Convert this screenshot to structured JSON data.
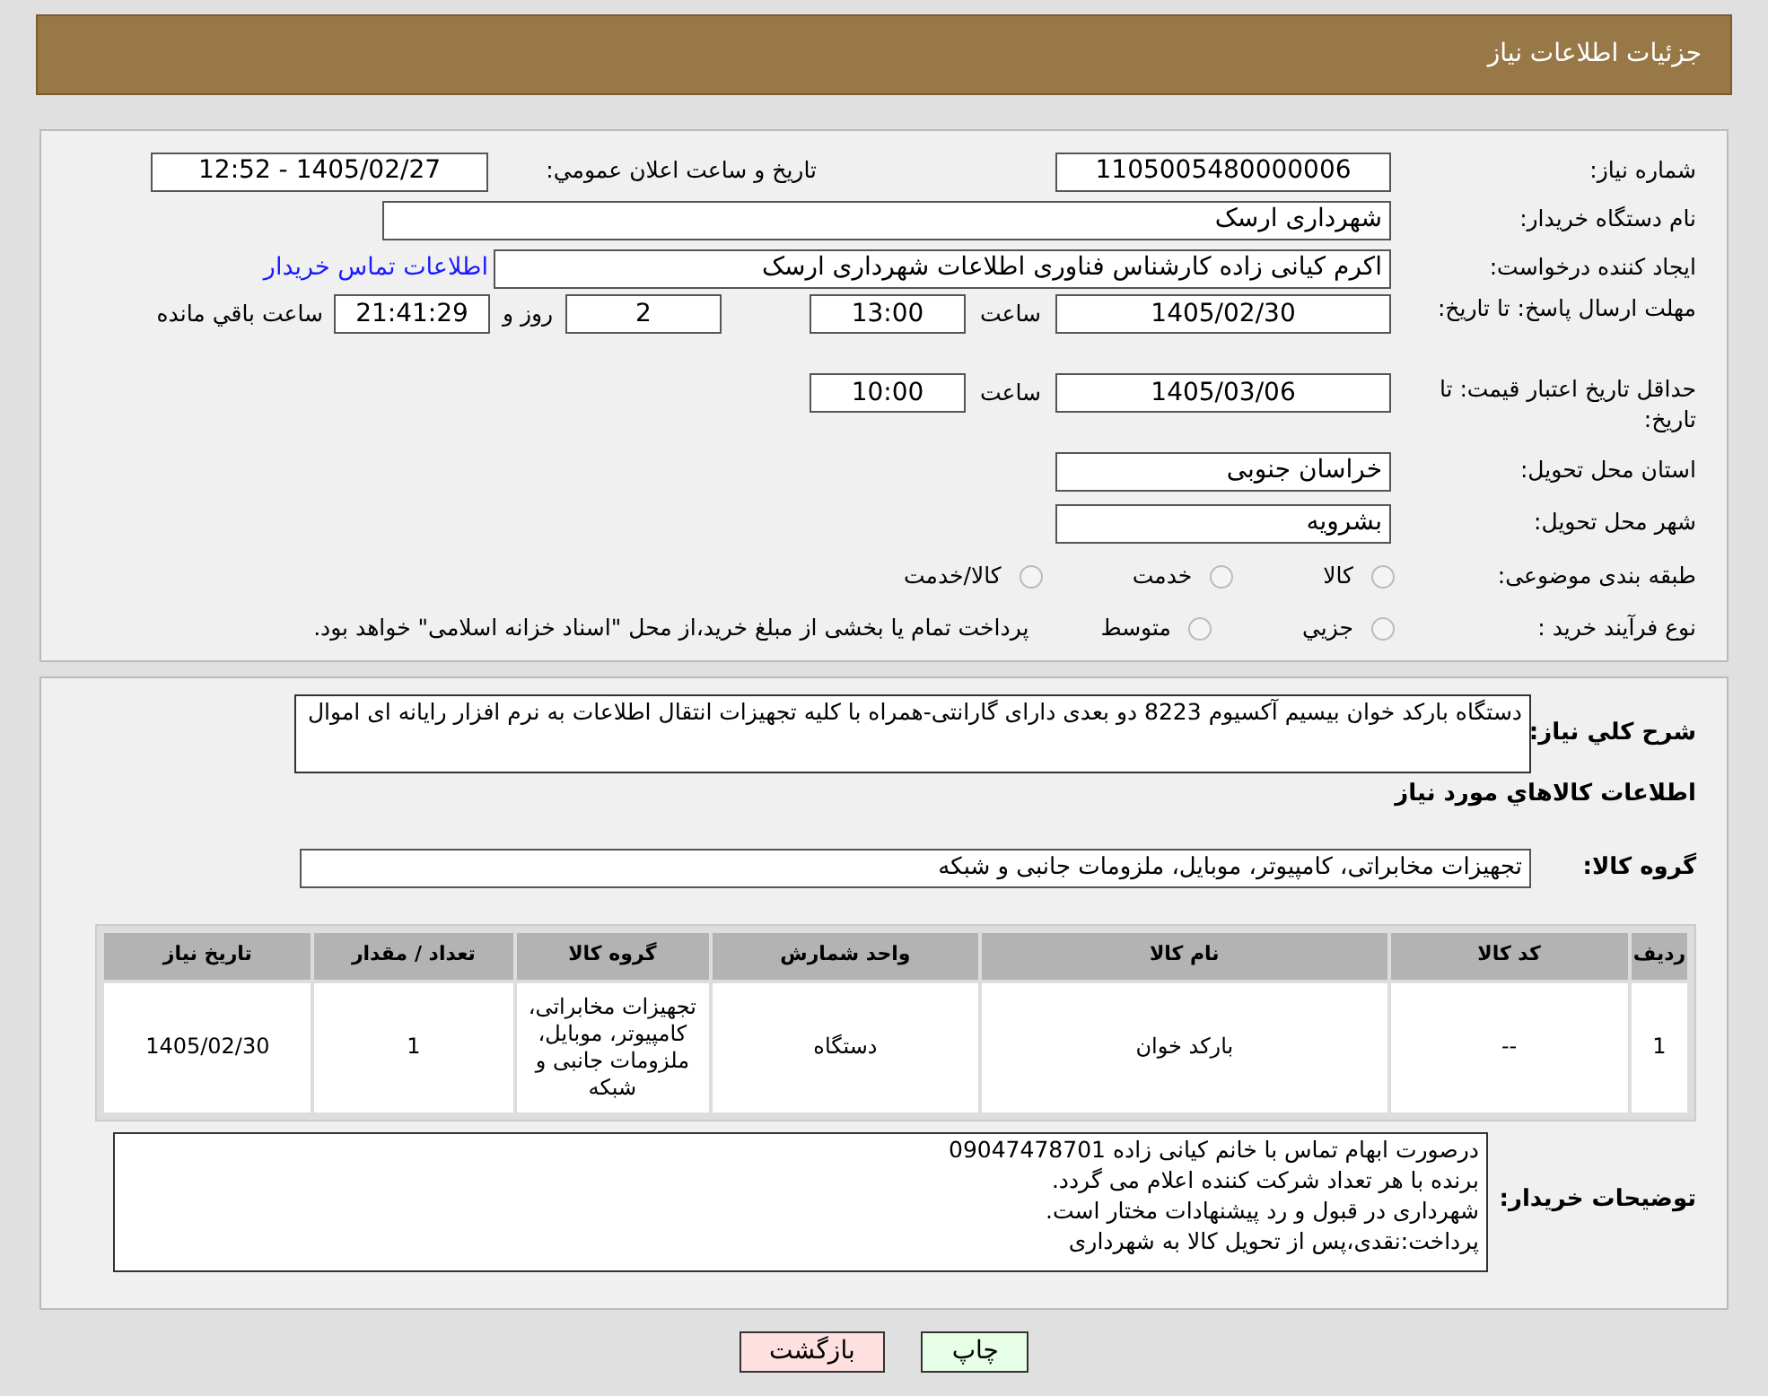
{
  "header": {
    "title": "جزئیات اطلاعات نیاز"
  },
  "need_number": {
    "label": "شماره نیاز:",
    "value": "1105005480000006"
  },
  "announce": {
    "label": "تاريخ و ساعت اعلان عمومي:",
    "value": "1405/02/27 - 12:52"
  },
  "buyer": {
    "label": "نام دستگاه خریدار:",
    "value": "شهرداری ارسک"
  },
  "creator": {
    "label": "ایجاد کننده درخواست:",
    "value": "اکرم کیانی زاده کارشناس فناوری اطلاعات شهرداری ارسک",
    "link": "اطلاعات تماس خریدار"
  },
  "deadline": {
    "label": "مهلت ارسال پاسخ: تا تاریخ:",
    "date": "1405/02/30",
    "time_label": "ساعت",
    "time": "13:00",
    "days": "2",
    "days_label": "روز و",
    "remaining": "21:41:29",
    "remaining_label": "ساعت باقي مانده"
  },
  "validity": {
    "label": "حداقل تاریخ اعتبار قیمت: تا تاریخ:",
    "date": "1405/03/06",
    "time_label": "ساعت",
    "time": "10:00"
  },
  "province": {
    "label": "استان محل تحویل:",
    "value": "خراسان جنوبی"
  },
  "city": {
    "label": "شهر محل تحویل:",
    "value": "بشرویه"
  },
  "category": {
    "label": "طبقه بندی موضوعی:",
    "options": [
      {
        "label": "کالا",
        "selected": false
      },
      {
        "label": "خدمت",
        "selected": false
      },
      {
        "label": "کالا/خدمت",
        "selected": false
      }
    ]
  },
  "process": {
    "label": "نوع فرآیند خرید :",
    "options": [
      {
        "label": "جزيي",
        "selected": false
      },
      {
        "label": "متوسط",
        "selected": false
      }
    ],
    "note": "پرداخت تمام یا بخشی از مبلغ خرید،از محل \"اسناد خزانه اسلامی\" خواهد بود."
  },
  "description": {
    "label": "شرح کلي نياز:",
    "value": "دستگاه بارکد خوان بیسیم آکسیوم 8223 دو بعدی دارای گارانتی-همراه با کلیه تجهیزات انتقال اطلاعات به نرم افزار رایانه ای اموال"
  },
  "goods_title": "اطلاعات کالاهاي مورد نياز",
  "goods_group": {
    "label": "گروه کالا:",
    "value": "تجهیزات مخابراتی، کامپیوتر، موبایل، ملزومات جانبی و شبکه"
  },
  "table": {
    "columns": [
      "رديف",
      "کد کالا",
      "نام کالا",
      "واحد شمارش",
      "گروه کالا",
      "تعداد / مقدار",
      "تاريخ نياز"
    ],
    "rows": [
      [
        "1",
        "--",
        "بارکد خوان",
        "دستگاه",
        "تجهیزات مخابراتی، کامپیوتر، موبایل، ملزومات جانبی و شبکه",
        "1",
        "1405/02/30"
      ]
    ]
  },
  "notes": {
    "label": "توضیحات خریدار:",
    "lines": [
      "درصورت ابهام تماس با خانم کیانی زاده 09047478701",
      "برنده با هر تعداد شرکت کننده اعلام می گردد.",
      "شهرداری در قبول و رد پیشنهادات مختار است.",
      "پرداخت:نقدی،پس از تحویل کالا به شهرداری"
    ]
  },
  "buttons": [
    {
      "label": "چاپ",
      "kind": "print"
    },
    {
      "label": "بازگشت",
      "kind": "back"
    }
  ]
}
